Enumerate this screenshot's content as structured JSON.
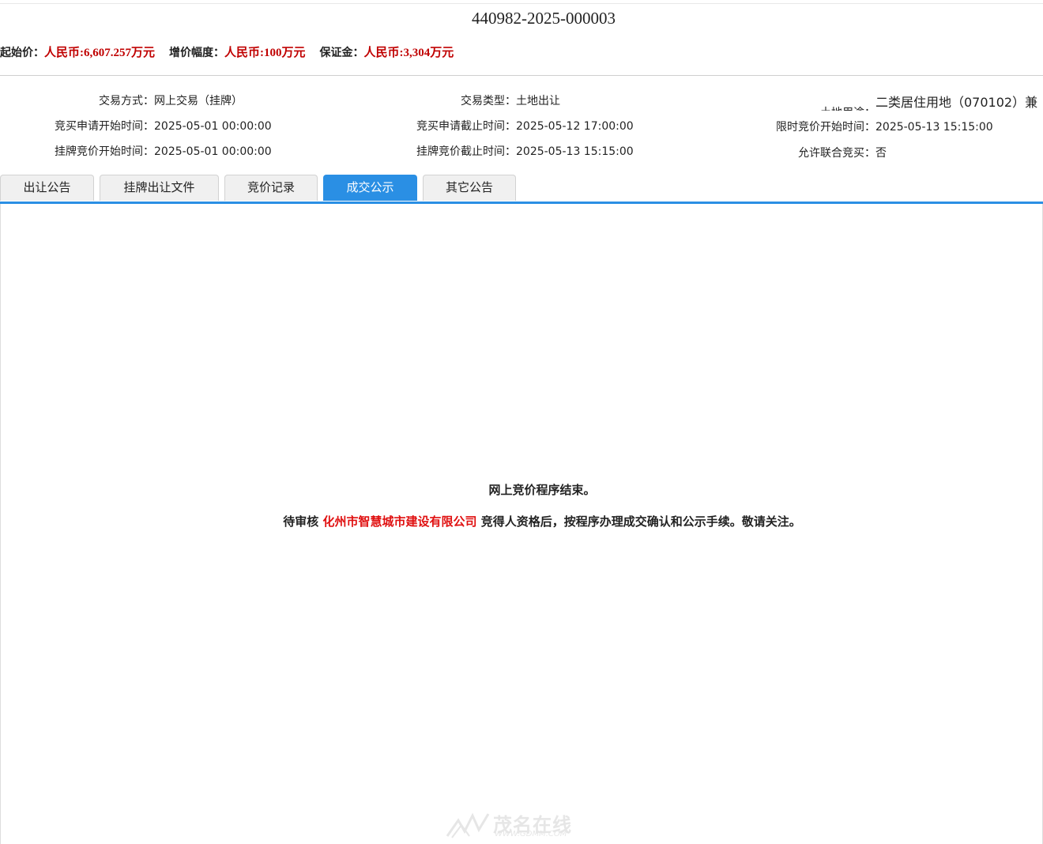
{
  "header": {
    "title": "440982-2025-000003",
    "starting_price_label": "起始价：",
    "starting_price": "人民币:6,607.257万元",
    "increment_label": "增价幅度：",
    "increment": "人民币:100万元",
    "deposit_label": "保证金：",
    "deposit": "人民币:3,304万元"
  },
  "info": {
    "trade_method_label": "交易方式：",
    "trade_method": "网上交易（挂牌）",
    "trade_type_label": "交易类型：",
    "trade_type": "土地出让",
    "land_use_label": "土地用途：",
    "land_use": "二类居住用地（070102）兼",
    "apply_start_label": "竞买申请开始时间：",
    "apply_start": "2025-05-01 00:00:00",
    "apply_end_label": "竞买申请截止时间：",
    "apply_end": "2025-05-12 17:00:00",
    "timed_start_label": "限时竞价开始时间：",
    "timed_start": "2025-05-13 15:15:00",
    "listing_start_label": "挂牌竞价开始时间：",
    "listing_start": "2025-05-01 00:00:00",
    "listing_end_label": "挂牌竞价截止时间：",
    "listing_end": "2025-05-13 15:15:00",
    "joint_bid_label": "允许联合竞买：",
    "joint_bid": "否"
  },
  "tabs": [
    {
      "label": "出让公告",
      "active": false
    },
    {
      "label": "挂牌出让文件",
      "active": false
    },
    {
      "label": "竞价记录",
      "active": false
    },
    {
      "label": "成交公示",
      "active": true
    },
    {
      "label": "其它公告",
      "active": false
    }
  ],
  "content": {
    "line1": "网上竞价程序结束。",
    "line2_prefix": "待审核 ",
    "company": "化州市智慧城市建设有限公司",
    "line2_suffix": " 竞得人资格后，按程序办理成交确认和公示手续。敬请关注。"
  },
  "watermark": {
    "text": "茂名在线",
    "url": "WWW.GDMM.COM"
  },
  "colors": {
    "accent": "#2a8fe4",
    "price_red": "#c00000",
    "company_red": "#e01010"
  }
}
